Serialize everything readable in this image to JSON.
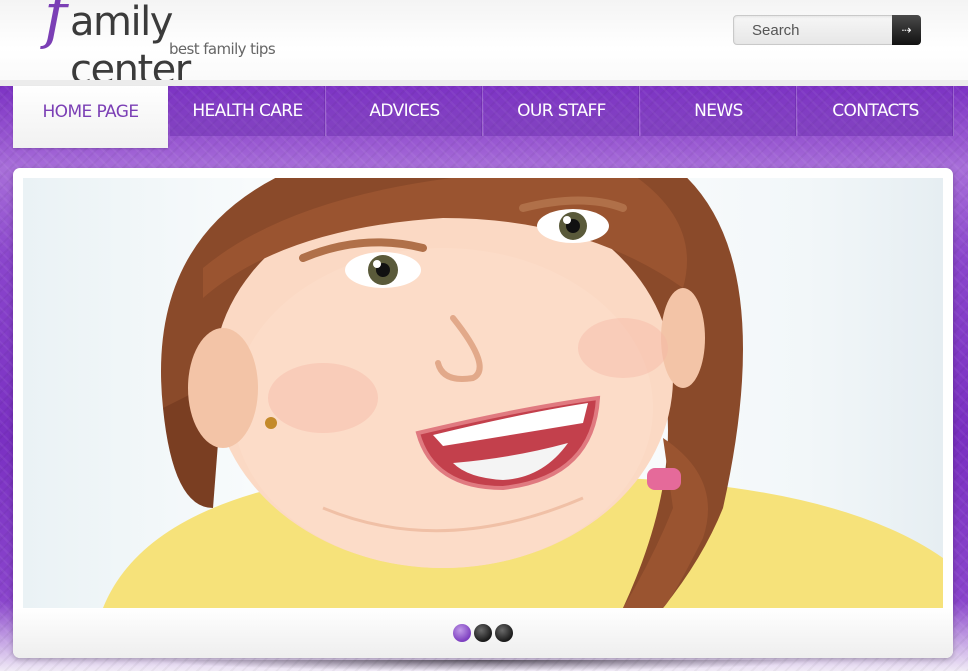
{
  "logo": {
    "initial": "f",
    "name": "amily center",
    "tagline": "best family tips"
  },
  "search": {
    "placeholder": "Search",
    "button_icon": "arrow-right-icon"
  },
  "nav": {
    "items": [
      {
        "label": "HOME PAGE",
        "active": true
      },
      {
        "label": "HEALTH CARE",
        "active": false
      },
      {
        "label": "ADVICES",
        "active": false
      },
      {
        "label": "OUR STAFF",
        "active": false
      },
      {
        "label": "NEWS",
        "active": false
      },
      {
        "label": "CONTACTS",
        "active": false
      }
    ]
  },
  "slider": {
    "image_subject": "smiling girl with braids in yellow shirt",
    "dots": [
      {
        "active": true
      },
      {
        "active": false
      },
      {
        "active": false
      }
    ]
  },
  "colors": {
    "brand_purple": "#7b3fb5",
    "band_purple": "#8a45cc",
    "text_dark": "#3b3b3b"
  }
}
